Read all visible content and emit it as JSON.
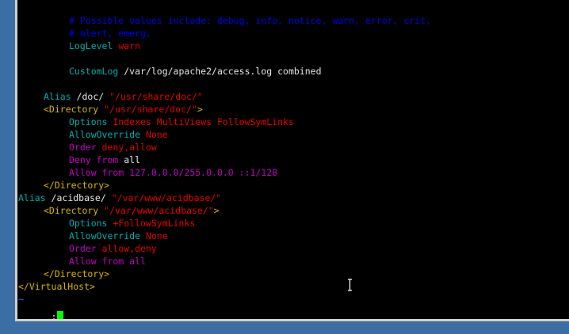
{
  "colors": {
    "comment": "#0000ee",
    "directive": "#00aaaa",
    "value": "#e60000",
    "plain": "#e8e8e8",
    "tag": "#d8b400",
    "order": "#c000c0",
    "cursor": "#00ff00",
    "tilde": "#5555ff"
  },
  "terminal": {
    "lines": [
      {
        "row": 0,
        "col": 8,
        "segments": [
          {
            "t": "# Possible values include: debug, info, notice, warn, error, crit,",
            "c": "comment"
          }
        ]
      },
      {
        "row": 1,
        "col": 8,
        "segments": [
          {
            "t": "# alert, emerg.",
            "c": "comment"
          }
        ]
      },
      {
        "row": 2,
        "col": 8,
        "segments": [
          {
            "t": "LogLevel ",
            "c": "directive"
          },
          {
            "t": "warn",
            "c": "value"
          }
        ]
      },
      {
        "row": 4,
        "col": 8,
        "segments": [
          {
            "t": "CustomLog ",
            "c": "directive"
          },
          {
            "t": "/var/log/apache2/access.log combined",
            "c": "plain"
          }
        ]
      },
      {
        "row": 6,
        "col": 4,
        "segments": [
          {
            "t": "Alias ",
            "c": "directive"
          },
          {
            "t": "/doc/ ",
            "c": "plain"
          },
          {
            "t": "\"/usr/share/doc/\"",
            "c": "value"
          }
        ]
      },
      {
        "row": 7,
        "col": 4,
        "segments": [
          {
            "t": "<Directory ",
            "c": "tag"
          },
          {
            "t": "\"/usr/share/doc/\"",
            "c": "value"
          },
          {
            "t": ">",
            "c": "tag"
          }
        ]
      },
      {
        "row": 8,
        "col": 8,
        "segments": [
          {
            "t": "Options ",
            "c": "directive"
          },
          {
            "t": "Indexes MultiViews FollowSymLinks",
            "c": "value"
          }
        ]
      },
      {
        "row": 9,
        "col": 8,
        "segments": [
          {
            "t": "AllowOverride ",
            "c": "directive"
          },
          {
            "t": "None",
            "c": "value"
          }
        ]
      },
      {
        "row": 10,
        "col": 8,
        "segments": [
          {
            "t": "Order ",
            "c": "order"
          },
          {
            "t": "deny,allow",
            "c": "value"
          }
        ]
      },
      {
        "row": 11,
        "col": 8,
        "segments": [
          {
            "t": "Deny from ",
            "c": "order"
          },
          {
            "t": "all",
            "c": "plain"
          }
        ]
      },
      {
        "row": 12,
        "col": 8,
        "segments": [
          {
            "t": "Allow from ",
            "c": "order"
          },
          {
            "t": "127.0.0.0/255.0.0.0 ::1/128",
            "c": "order"
          }
        ]
      },
      {
        "row": 13,
        "col": 4,
        "segments": [
          {
            "t": "</Directory>",
            "c": "tag"
          }
        ]
      },
      {
        "row": 14,
        "col": 0,
        "segments": [
          {
            "t": "Alias ",
            "c": "directive"
          },
          {
            "t": "/acidbase/ ",
            "c": "plain"
          },
          {
            "t": "\"/var/www/acidbase/\"",
            "c": "value"
          }
        ]
      },
      {
        "row": 15,
        "col": 4,
        "segments": [
          {
            "t": "<Directory ",
            "c": "tag"
          },
          {
            "t": "\"/var/www/acidbase/\"",
            "c": "value"
          },
          {
            "t": ">",
            "c": "tag"
          }
        ]
      },
      {
        "row": 16,
        "col": 8,
        "segments": [
          {
            "t": "Options ",
            "c": "directive"
          },
          {
            "t": "+FollowSymLinks",
            "c": "value"
          }
        ]
      },
      {
        "row": 17,
        "col": 8,
        "segments": [
          {
            "t": "AllowOverride ",
            "c": "directive"
          },
          {
            "t": "None",
            "c": "value"
          }
        ]
      },
      {
        "row": 18,
        "col": 8,
        "segments": [
          {
            "t": "Order ",
            "c": "order"
          },
          {
            "t": "allow,deny",
            "c": "value"
          }
        ]
      },
      {
        "row": 19,
        "col": 8,
        "segments": [
          {
            "t": "Allow from ",
            "c": "order"
          },
          {
            "t": "all",
            "c": "order"
          }
        ]
      },
      {
        "row": 20,
        "col": 4,
        "segments": [
          {
            "t": "</Directory>",
            "c": "tag"
          }
        ]
      },
      {
        "row": 21,
        "col": 0,
        "segments": [
          {
            "t": "</VirtualHost>",
            "c": "tag"
          }
        ]
      },
      {
        "row": 22,
        "col": 0,
        "segments": [
          {
            "t": "~",
            "c": "tilde"
          }
        ]
      }
    ],
    "command_line": {
      "row": 23,
      "prompt": ":"
    }
  },
  "icons": {
    "mouse_pointer": "text-cursor-ibeam-icon"
  }
}
